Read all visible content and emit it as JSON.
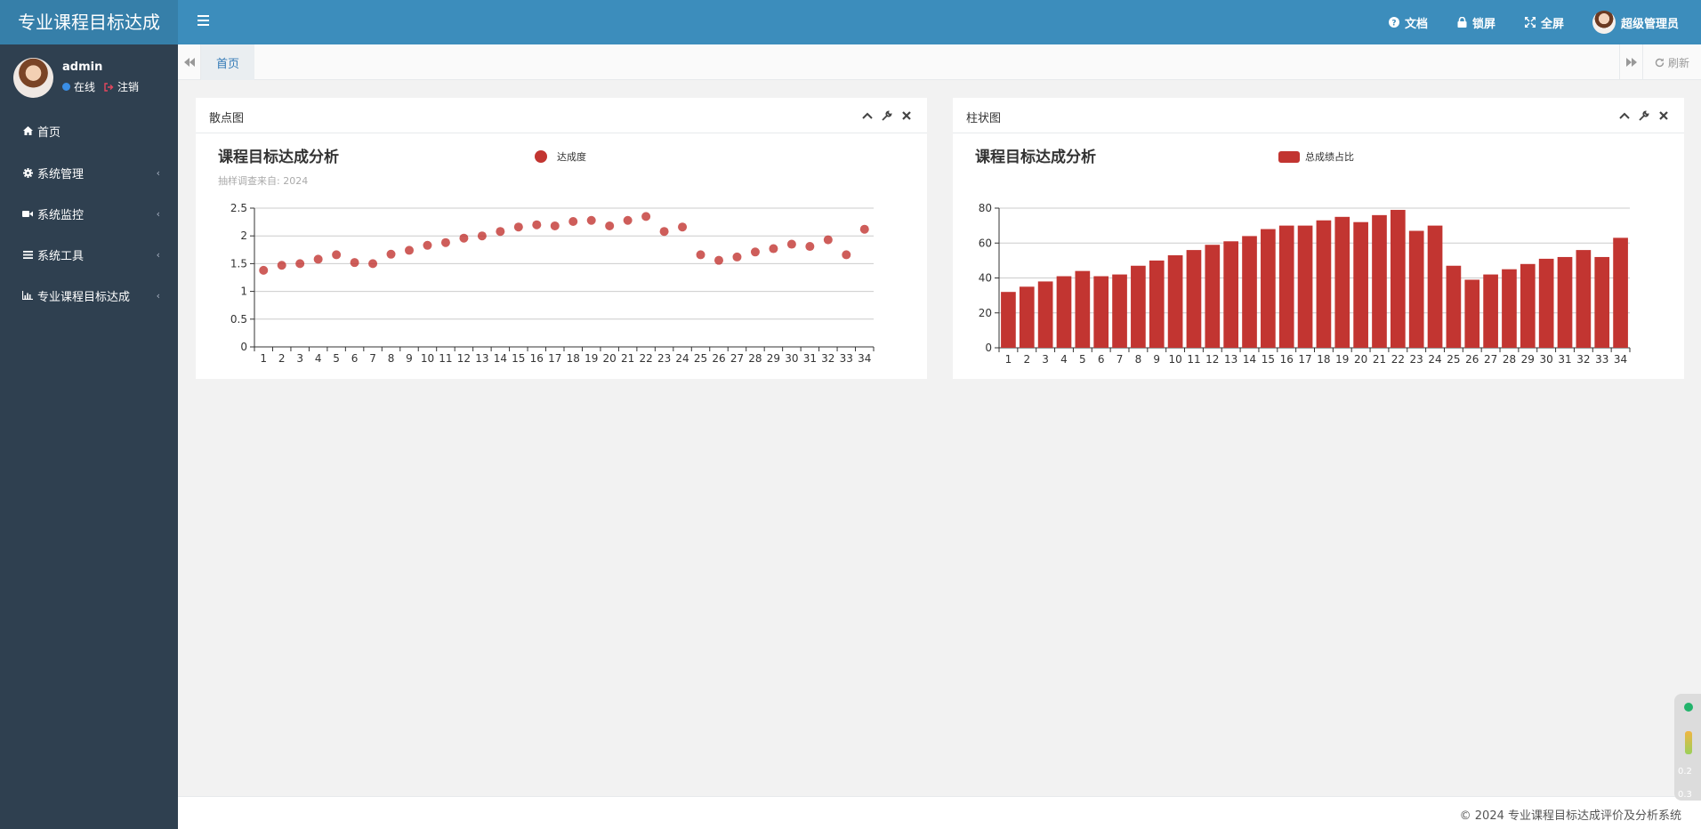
{
  "app": {
    "title": "专业课程目标达成"
  },
  "header": {
    "docs": "文档",
    "lock": "锁屏",
    "fullscreen": "全屏",
    "user": "超级管理员"
  },
  "sidebar": {
    "user": {
      "name": "admin",
      "status": "在线",
      "logout": "注销"
    },
    "items": [
      {
        "label": "首页",
        "icon": "home-icon"
      },
      {
        "label": "系统管理",
        "icon": "gear-icon"
      },
      {
        "label": "系统监控",
        "icon": "video-icon"
      },
      {
        "label": "系统工具",
        "icon": "bars-icon"
      },
      {
        "label": "专业课程目标达成",
        "icon": "bar-chart-icon"
      }
    ]
  },
  "tabs": {
    "home": "首页",
    "refresh": "刷新"
  },
  "panels": {
    "scatter": {
      "title": "散点图"
    },
    "bar": {
      "title": "柱状图"
    }
  },
  "footer": {
    "text": "© 2024 专业课程目标达成评价及分析系统"
  },
  "widget": {
    "up": "0.2",
    "down": "0.3",
    "unit": "K/s"
  },
  "colors": {
    "accent": "#3c8dbc",
    "sidebar": "#2f4050",
    "series": "#c23531"
  },
  "chart_data": [
    {
      "type": "scatter",
      "title": "课程目标达成分析",
      "subtitle": "抽样调查来自: 2024",
      "legend": "达成度",
      "legend_position": "top-center",
      "categories": [
        "1",
        "2",
        "3",
        "4",
        "5",
        "6",
        "7",
        "8",
        "9",
        "10",
        "11",
        "12",
        "13",
        "14",
        "15",
        "16",
        "17",
        "18",
        "19",
        "20",
        "21",
        "22",
        "23",
        "24",
        "25",
        "26",
        "27",
        "28",
        "29",
        "30",
        "31",
        "32",
        "33",
        "34"
      ],
      "values": [
        1.38,
        1.47,
        1.5,
        1.58,
        1.66,
        1.52,
        1.5,
        1.67,
        1.74,
        1.83,
        1.88,
        1.96,
        2.0,
        2.08,
        2.16,
        2.2,
        2.18,
        2.26,
        2.28,
        2.18,
        2.28,
        2.35,
        2.08,
        2.16,
        1.66,
        1.56,
        1.62,
        1.71,
        1.77,
        1.85,
        1.81,
        1.93,
        1.66,
        2.12
      ],
      "ylim": [
        0,
        2.5
      ],
      "yticks": [
        "0",
        "0.5",
        "1",
        "1.5",
        "2",
        "2.5"
      ],
      "grid": true
    },
    {
      "type": "bar",
      "title": "课程目标达成分析",
      "legend": "总成绩占比",
      "legend_position": "top-center",
      "categories": [
        "1",
        "2",
        "3",
        "4",
        "5",
        "6",
        "7",
        "8",
        "9",
        "10",
        "11",
        "12",
        "13",
        "14",
        "15",
        "16",
        "17",
        "18",
        "19",
        "20",
        "21",
        "22",
        "23",
        "24",
        "25",
        "26",
        "27",
        "28",
        "29",
        "30",
        "31",
        "32",
        "33",
        "34"
      ],
      "values": [
        32,
        35,
        38,
        41,
        44,
        41,
        42,
        47,
        50,
        53,
        56,
        59,
        61,
        64,
        68,
        70,
        70,
        73,
        75,
        72,
        76,
        79,
        67,
        70,
        47,
        39,
        42,
        45,
        48,
        51,
        52,
        56,
        52,
        63
      ],
      "ylim": [
        0,
        80
      ],
      "yticks": [
        "0",
        "20",
        "40",
        "60",
        "80"
      ],
      "grid": true
    }
  ]
}
